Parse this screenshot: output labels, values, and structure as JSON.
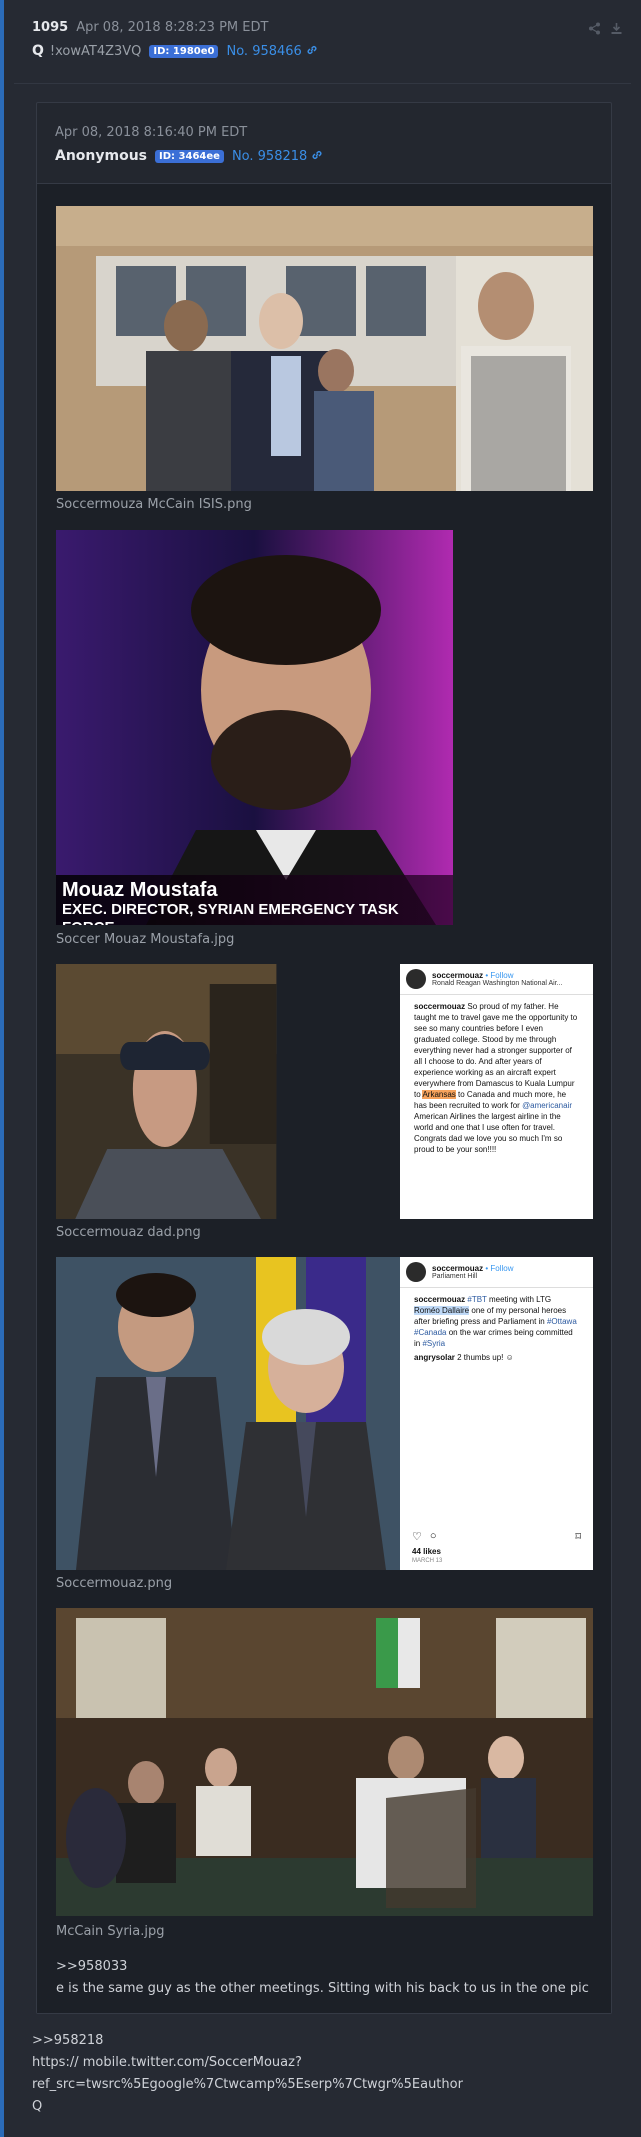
{
  "post": {
    "number": "1095",
    "date": "Apr 08, 2018 8:28:23 PM EDT",
    "author": "Q",
    "tripcode": "!xowAT4Z3VQ",
    "id": "ID: 1980e0",
    "post_link": "No. 958466",
    "icons": [
      "share-icon",
      "download-icon",
      "link-icon"
    ]
  },
  "quoted": {
    "date": "Apr 08, 2018 8:16:40 PM EDT",
    "author": "Anonymous",
    "id": "ID: 3464ee",
    "post_link": "No. 958218",
    "images": [
      {
        "caption": "Soccermouza McCain ISIS.png"
      },
      {
        "caption": "Soccer Mouaz Moustafa.jpg",
        "overlay_name": "Mouaz Moustafa",
        "overlay_title": "EXEC. DIRECTOR, SYRIAN EMERGENCY TASK FORCE"
      },
      {
        "caption": "Soccermouaz dad.png"
      },
      {
        "caption": "Soccermouaz.png"
      },
      {
        "caption": "McCain Syria.jpg"
      }
    ],
    "insta1": {
      "user": "soccermouaz",
      "follow": " • Follow",
      "location": "Ronald Reagan Washington National Air...",
      "text_a": "So proud of my father. He taught me to travel gave me the opportunity to see so many countries before I even graduated college. Stood by me through everything never had a stronger supporter of all I choose to do. And after years of experience working as an aircraft expert everywhere from Damascus to Kuala Lumpur to ",
      "hl": "Arkansas",
      "text_b": " to Canada and much more, he has been recruited to work for ",
      "tag": "@americanair",
      "text_c": " American Airlines the largest airline in the world and one that I use often for travel. Congrats dad we love you so much I'm so proud to be your son!!!!"
    },
    "insta2": {
      "user": "soccermouaz",
      "follow": " • Follow",
      "location": "Parliament Hill",
      "tag1": "#TBT",
      "text_a": " meeting with LTG ",
      "hl": "Roméo Dallaire",
      "text_b": " one of my personal heroes after briefing press and Parliament in ",
      "tag2": "#Ottawa #Canada",
      "text_c": " on the war crimes being committed in ",
      "tag3": "#Syria",
      "comment_user": "angrysolar",
      "comment": " 2 thumbs up! ☺",
      "likes": "44 likes",
      "date": "MARCH 13"
    },
    "reply_ref": ">>958033",
    "reply_text": "e is the same guy as the other meetings. Sitting with his back to us in the one pic"
  },
  "body": {
    "line1": ">>958218",
    "line2": "https:// mobile.twitter.com/SoccerMouaz?",
    "line3": "ref_src=twsrc%5Egoogle%7Ctwcamp%5Eserp%7Ctwgr%5Eauthor",
    "line4": "Q"
  }
}
